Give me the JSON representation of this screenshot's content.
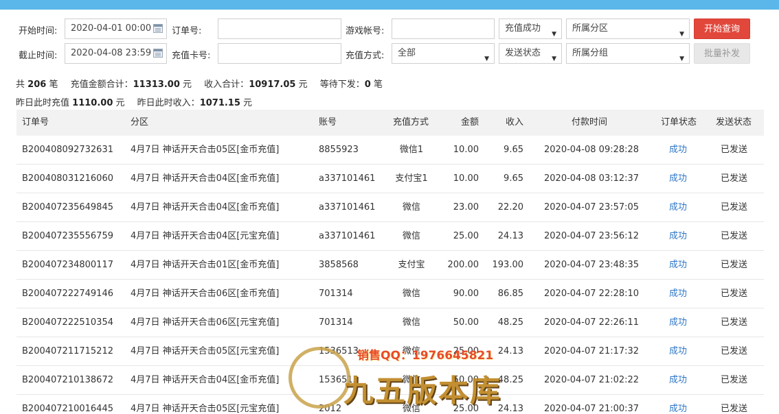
{
  "filters": {
    "start_label": "开始时间:",
    "start_value": "2020-04-01 00:00",
    "end_label": "截止时间:",
    "end_value": "2020-04-08 23:59",
    "order_label": "订单号:",
    "order_value": "",
    "card_label": "充值卡号:",
    "card_value": "",
    "account_label": "游戏帐号:",
    "account_value": "",
    "method_label": "充值方式:",
    "method_value": "全部",
    "status_value": "充值成功",
    "send_status_value": "发送状态",
    "zone_value": "所属分区",
    "group_value": "所属分组",
    "search_button": "开始查询",
    "batch_button": "批量补发"
  },
  "stats": {
    "total_prefix": "共",
    "total_count": "206",
    "total_unit": "笔",
    "amount_label": "充值金额合计：",
    "amount_value": "11313.00",
    "amount_unit": "元",
    "income_label": "收入合计：",
    "income_value": "10917.05",
    "income_unit": "元",
    "pending_label": "等待下发：",
    "pending_value": "0",
    "pending_unit": "笔",
    "yest_recharge_label": "昨日此时充值",
    "yest_recharge_value": "1110.00",
    "yest_recharge_unit": "元",
    "yest_income_label": "昨日此时收入：",
    "yest_income_value": "1071.15",
    "yest_income_unit": "元"
  },
  "table": {
    "headers": {
      "order": "订单号",
      "zone": "分区",
      "account": "账号",
      "method": "充值方式",
      "amount": "金额",
      "income": "收入",
      "paytime": "付款时间",
      "order_status": "订单状态",
      "send_status": "发送状态"
    },
    "rows": [
      {
        "order": "B200408092732631",
        "zone": "4月7日 神话开天合击05区[金币充值]",
        "account": "8855923",
        "method": "微信1",
        "amount": "10.00",
        "income": "9.65",
        "paytime": "2020-04-08 09:28:28",
        "status": "成功",
        "send": "已发送"
      },
      {
        "order": "B200408031216060",
        "zone": "4月7日 神话开天合击04区[金币充值]",
        "account": "a337101461",
        "method": "支付宝1",
        "amount": "10.00",
        "income": "9.65",
        "paytime": "2020-04-08 03:12:37",
        "status": "成功",
        "send": "已发送"
      },
      {
        "order": "B200407235649845",
        "zone": "4月7日 神话开天合击04区[金币充值]",
        "account": "a337101461",
        "method": "微信",
        "amount": "23.00",
        "income": "22.20",
        "paytime": "2020-04-07 23:57:05",
        "status": "成功",
        "send": "已发送"
      },
      {
        "order": "B200407235556759",
        "zone": "4月7日 神话开天合击04区[元宝充值]",
        "account": "a337101461",
        "method": "微信",
        "amount": "25.00",
        "income": "24.13",
        "paytime": "2020-04-07 23:56:12",
        "status": "成功",
        "send": "已发送"
      },
      {
        "order": "B200407234800117",
        "zone": "4月7日 神话开天合击01区[金币充值]",
        "account": "3858568",
        "method": "支付宝",
        "amount": "200.00",
        "income": "193.00",
        "paytime": "2020-04-07 23:48:35",
        "status": "成功",
        "send": "已发送"
      },
      {
        "order": "B200407222749146",
        "zone": "4月7日 神话开天合击06区[金币充值]",
        "account": "701314",
        "method": "微信",
        "amount": "90.00",
        "income": "86.85",
        "paytime": "2020-04-07 22:28:10",
        "status": "成功",
        "send": "已发送"
      },
      {
        "order": "B200407222510354",
        "zone": "4月7日 神话开天合击06区[元宝充值]",
        "account": "701314",
        "method": "微信",
        "amount": "50.00",
        "income": "48.25",
        "paytime": "2020-04-07 22:26:11",
        "status": "成功",
        "send": "已发送"
      },
      {
        "order": "B200407211715212",
        "zone": "4月7日 神话开天合击05区[元宝充值]",
        "account": "1536513",
        "method": "微信",
        "amount": "25.00",
        "income": "24.13",
        "paytime": "2020-04-07 21:17:32",
        "status": "成功",
        "send": "已发送"
      },
      {
        "order": "B200407210138672",
        "zone": "4月7日 神话开天合击04区[金币充值]",
        "account": "1536513",
        "method": "微信",
        "amount": "50.00",
        "income": "48.25",
        "paytime": "2020-04-07 21:02:22",
        "status": "成功",
        "send": "已发送"
      },
      {
        "order": "B200407210016445",
        "zone": "4月7日 神话开天合击05区[元宝充值]",
        "account": "2012",
        "method": "微信",
        "amount": "25.00",
        "income": "24.13",
        "paytime": "2020-04-07 21:00:37",
        "status": "成功",
        "send": "已发送"
      }
    ]
  },
  "watermark": {
    "qq": "销售QQ：1976645821",
    "brand": "九五版本库"
  },
  "colors": {
    "banner": "#5bb7ea",
    "primary_button": "#e2473b",
    "link": "#2d76c7",
    "header_bg": "#f2f2f2"
  }
}
